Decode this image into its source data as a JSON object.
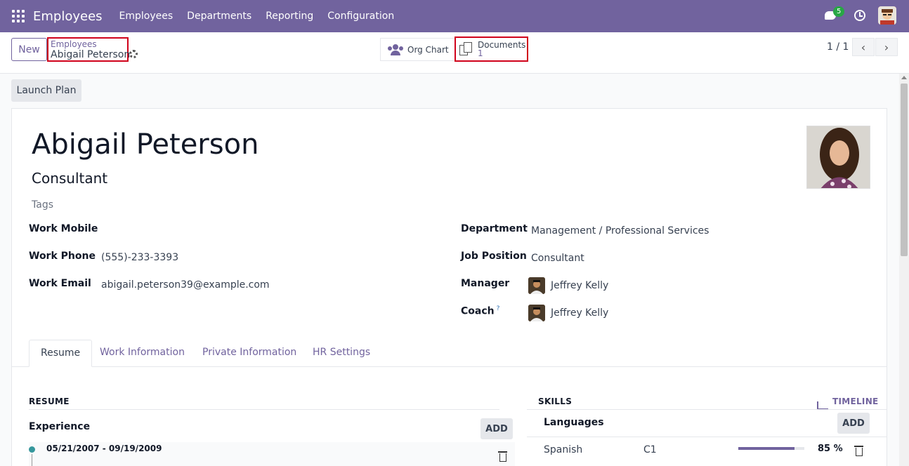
{
  "nav": {
    "app_name": "Employees",
    "menu": [
      "Employees",
      "Departments",
      "Reporting",
      "Configuration"
    ],
    "chat_badge": "5"
  },
  "control": {
    "new_label": "New",
    "breadcrumb_parent": "Employees",
    "breadcrumb_current": "Abigail Peterson",
    "org_chart_label": "Org Chart",
    "documents_label": "Documents",
    "documents_count": "1",
    "pager": "1 / 1"
  },
  "actions": {
    "launch_plan": "Launch Plan"
  },
  "employee": {
    "name": "Abigail Peterson",
    "job_title": "Consultant",
    "tags_placeholder": "Tags"
  },
  "fields_left": {
    "work_mobile_label": "Work Mobile",
    "work_mobile_value": "",
    "work_phone_label": "Work Phone",
    "work_phone_value": "(555)-233-3393",
    "work_email_label": "Work Email",
    "work_email_value": "abigail.peterson39@example.com"
  },
  "fields_right": {
    "department_label": "Department",
    "department_value": "Management / Professional Services",
    "job_position_label": "Job Position",
    "job_position_value": "Consultant",
    "manager_label": "Manager",
    "manager_value": "Jeffrey Kelly",
    "coach_label": "Coach",
    "coach_help": "?",
    "coach_value": "Jeffrey Kelly"
  },
  "tabs": [
    "Resume",
    "Work Information",
    "Private Information",
    "HR Settings"
  ],
  "resume": {
    "title": "RESUME",
    "experience_label": "Experience",
    "add_label": "ADD",
    "entry_dates": "05/21/2007 - 09/19/2009"
  },
  "skills": {
    "title": "SKILLS",
    "timeline_label": "TIMELINE",
    "group_label": "Languages",
    "add_label": "ADD",
    "skill_name": "Spanish",
    "skill_level": "C1",
    "skill_progress": 85,
    "skill_percent": "85 %"
  },
  "colors": {
    "brand": "#71639e",
    "highlight": "#d0021b",
    "badge": "#28a745"
  }
}
